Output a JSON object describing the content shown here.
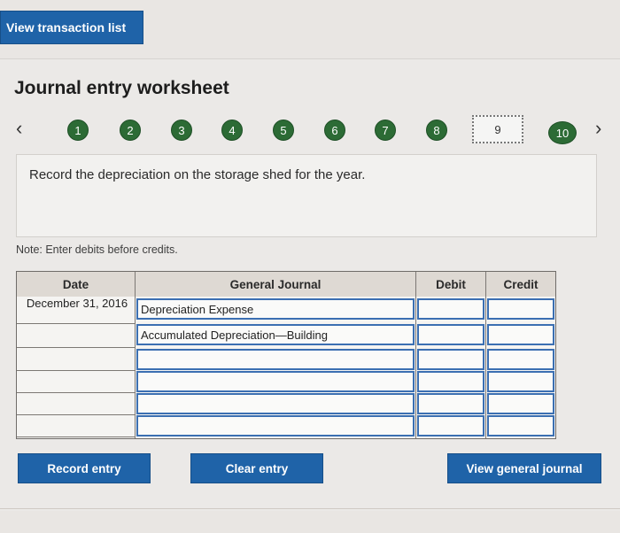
{
  "top_button": {
    "label": "View transaction list"
  },
  "title": "Journal entry worksheet",
  "nav": {
    "prev_icon": "chevron-left-icon",
    "next_icon": "chevron-right-icon",
    "steps": [
      "1",
      "2",
      "3",
      "4",
      "5",
      "6",
      "7",
      "8",
      "9",
      "10"
    ],
    "current_step": "9"
  },
  "instruction": "Record the depreciation on the storage shed for the year.",
  "note": "Note: Enter debits before credits.",
  "table": {
    "headers": {
      "date": "Date",
      "journal": "General Journal",
      "debit": "Debit",
      "credit": "Credit"
    },
    "rows": [
      {
        "date": "December 31, 2016",
        "account": "Depreciation Expense",
        "debit": "",
        "credit": ""
      },
      {
        "date": "",
        "account": "Accumulated Depreciation—Building",
        "debit": "",
        "credit": ""
      },
      {
        "date": "",
        "account": "",
        "debit": "",
        "credit": ""
      },
      {
        "date": "",
        "account": "",
        "debit": "",
        "credit": ""
      },
      {
        "date": "",
        "account": "",
        "debit": "",
        "credit": ""
      },
      {
        "date": "",
        "account": "",
        "debit": "",
        "credit": ""
      }
    ]
  },
  "buttons": {
    "record": "Record entry",
    "clear": "Clear entry",
    "view_journal": "View general journal"
  },
  "colors": {
    "primary_blue": "#1f63a8",
    "step_green": "#2c6b35"
  }
}
